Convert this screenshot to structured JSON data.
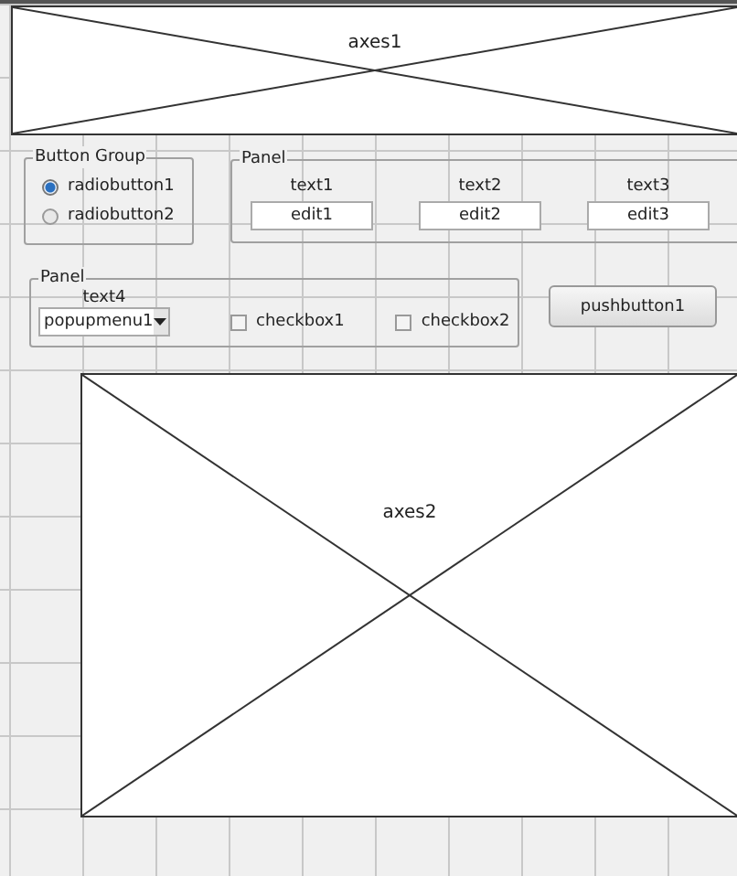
{
  "axes": [
    {
      "label": "axes1"
    },
    {
      "label": "axes2"
    }
  ],
  "button_group": {
    "title": "Button Group",
    "radios": [
      {
        "label": "radiobutton1",
        "selected": true
      },
      {
        "label": "radiobutton2",
        "selected": false
      }
    ]
  },
  "panel_1": {
    "title": "Panel",
    "fields": [
      {
        "label": "text1",
        "value": "edit1"
      },
      {
        "label": "text2",
        "value": "edit2"
      },
      {
        "label": "text3",
        "value": "edit3"
      }
    ]
  },
  "panel_2": {
    "title": "Panel",
    "popup_label": "text4",
    "popup_value": "popupmenu1",
    "checkboxes": [
      {
        "label": "checkbox1",
        "checked": false
      },
      {
        "label": "checkbox2",
        "checked": false
      }
    ]
  },
  "pushbutton": {
    "label": "pushbutton1"
  }
}
